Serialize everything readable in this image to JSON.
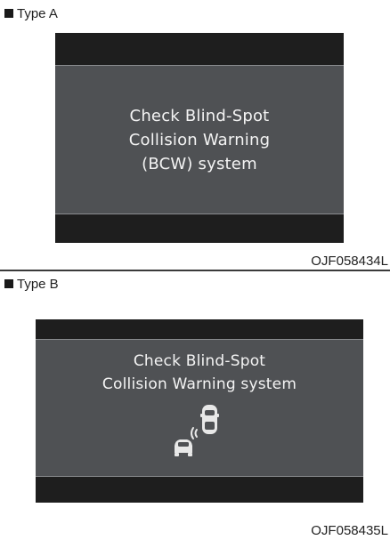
{
  "type_a": {
    "label": "Type A",
    "message_lines": [
      "Check Blind-Spot",
      "Collision Warning",
      "(BCW) system"
    ],
    "image_code": "OJF058434L"
  },
  "type_b": {
    "label": "Type B",
    "message_lines": [
      "Check Blind-Spot",
      "Collision Warning system"
    ],
    "icon": "blind-spot-collision-warning-cars-icon",
    "image_code": "OJF058435L"
  },
  "colors": {
    "screen_frame": "#1e1e1e",
    "screen_panel": "#4f5154",
    "message_text": "#f4f4f4",
    "divider": "#3a3a3a"
  }
}
